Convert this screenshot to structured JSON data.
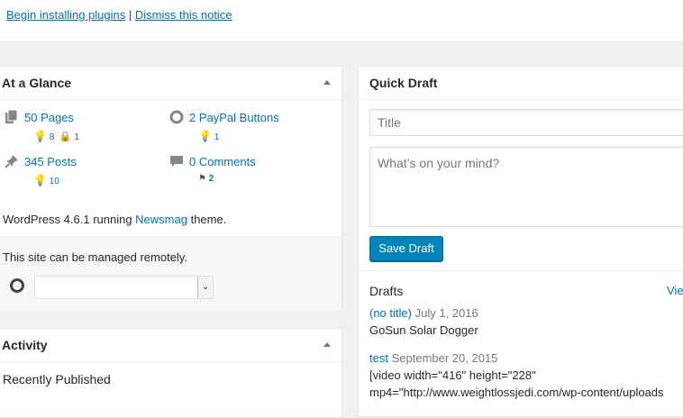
{
  "notice": {
    "begin_label": "Begin installing plugins",
    "separator": "|",
    "dismiss_label": "Dismiss this notice"
  },
  "at_a_glance": {
    "title": "At a Glance",
    "pages": {
      "label": "50 Pages",
      "sub1": "8",
      "sub2": "1"
    },
    "paypal": {
      "label": "2 PayPal Buttons",
      "sub1": "1"
    },
    "posts": {
      "label": "345 Posts",
      "sub1": "10"
    },
    "comments": {
      "label": "0 Comments",
      "sub1": "2"
    },
    "wp_info_prefix": "WordPress 4.6.1 running ",
    "theme_link": "Newsmag",
    "wp_info_suffix": " theme.",
    "remote_text": "This site can be managed remotely.",
    "select_value": ""
  },
  "activity": {
    "title": "Activity",
    "recently_published": "Recently Published"
  },
  "quick_draft": {
    "title": "Quick Draft",
    "title_placeholder": "Title",
    "body_placeholder": "What’s on your mind?",
    "save_label": "Save Draft",
    "drafts_heading": "Drafts",
    "view_all": "Vie",
    "drafts": [
      {
        "title": "(no title)",
        "date": "July 1, 2016",
        "excerpt": "GoSun Solar Dogger"
      },
      {
        "title": "test",
        "date": "September 20, 2015",
        "excerpt": "[video width=\"416\" height=\"228\"",
        "excerpt2": "mp4=\"http://www.weightlossjedi.com/wp-content/uploads"
      }
    ]
  },
  "colors": {
    "link": "#0073aa",
    "button": "#0085ba",
    "background": "#f1f1f1"
  }
}
